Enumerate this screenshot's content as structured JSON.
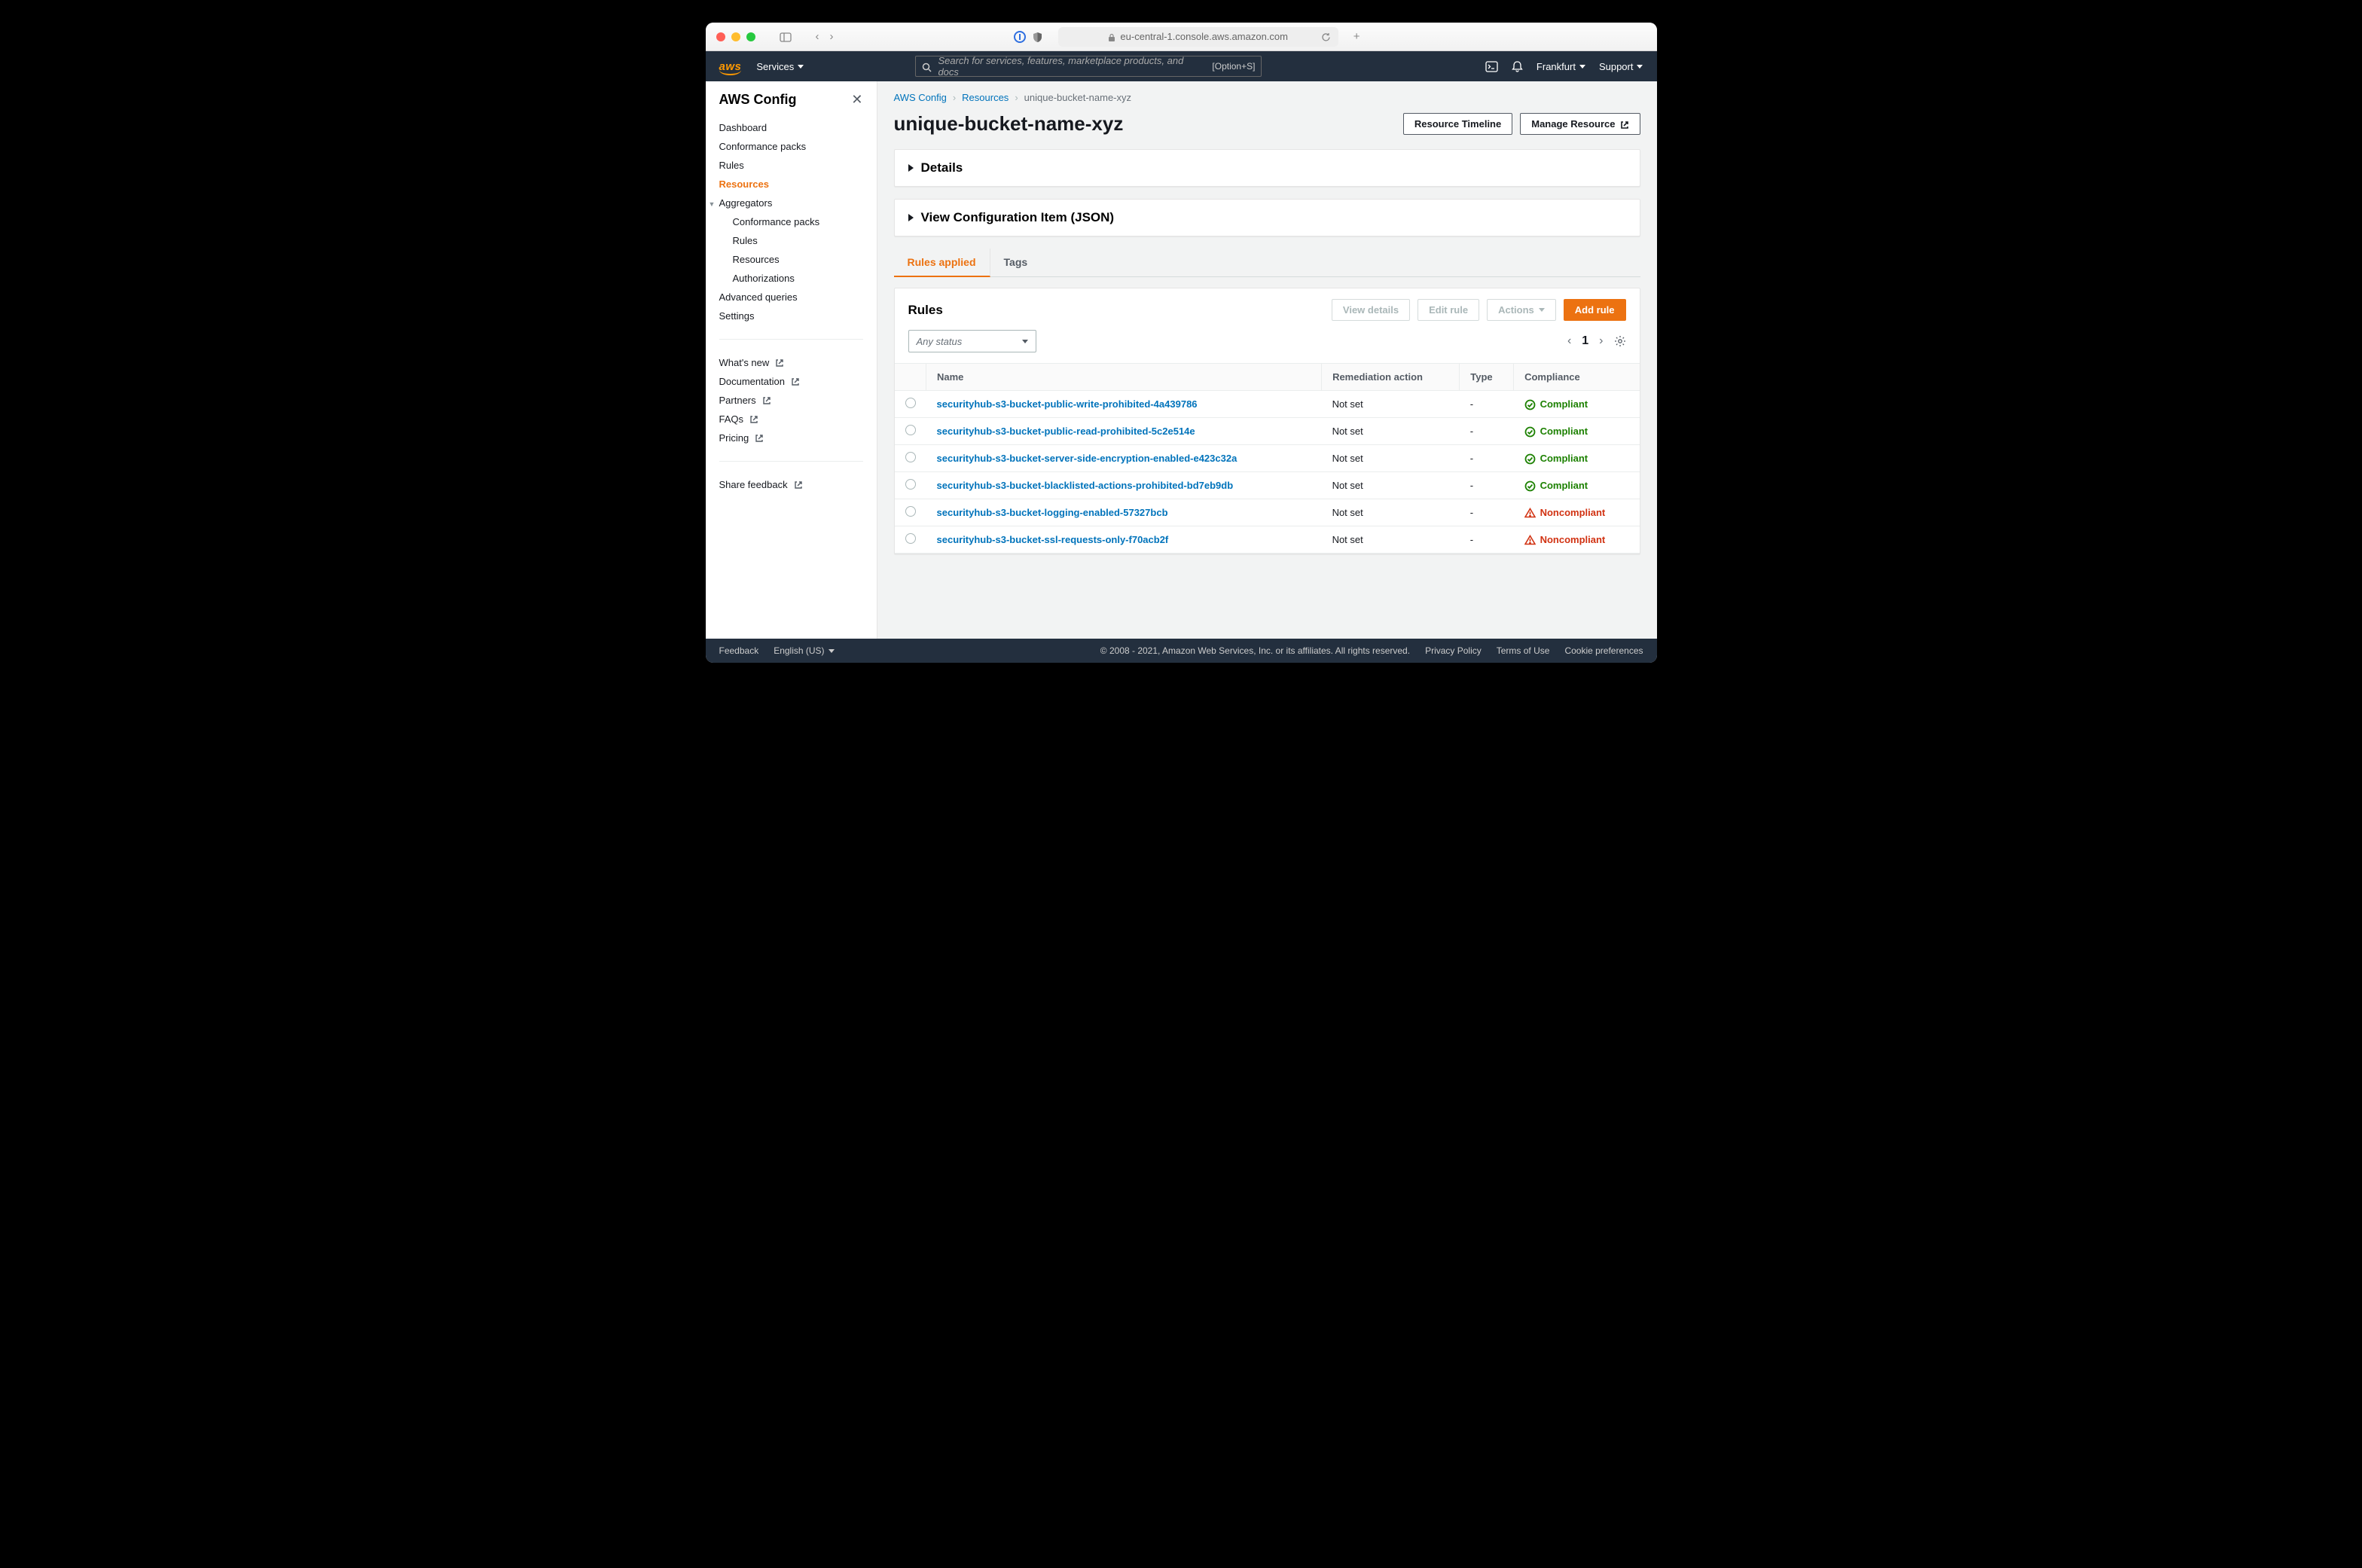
{
  "browser": {
    "url": "eu-central-1.console.aws.amazon.com"
  },
  "topnav": {
    "services": "Services",
    "search_placeholder": "Search for services, features, marketplace products, and docs",
    "search_hint": "[Option+S]",
    "region": "Frankfurt",
    "support": "Support"
  },
  "sidebar": {
    "title": "AWS Config",
    "items": [
      {
        "label": "Dashboard"
      },
      {
        "label": "Conformance packs"
      },
      {
        "label": "Rules"
      },
      {
        "label": "Resources",
        "active": true
      },
      {
        "label": "Aggregators",
        "expandable": true
      },
      {
        "label": "Conformance packs",
        "sub": true
      },
      {
        "label": "Rules",
        "sub": true
      },
      {
        "label": "Resources",
        "sub": true
      },
      {
        "label": "Authorizations",
        "sub": true
      },
      {
        "label": "Advanced queries"
      },
      {
        "label": "Settings"
      }
    ],
    "ext": [
      {
        "label": "What's new"
      },
      {
        "label": "Documentation"
      },
      {
        "label": "Partners"
      },
      {
        "label": "FAQs"
      },
      {
        "label": "Pricing"
      }
    ],
    "share": "Share feedback"
  },
  "breadcrumbs": [
    {
      "label": "AWS Config",
      "link": true
    },
    {
      "label": "Resources",
      "link": true
    },
    {
      "label": "unique-bucket-name-xyz"
    }
  ],
  "page": {
    "title": "unique-bucket-name-xyz",
    "timeline_btn": "Resource Timeline",
    "manage_btn": "Manage Resource"
  },
  "panels": {
    "details": "Details",
    "json": "View Configuration Item (JSON)"
  },
  "tabs": {
    "applied": "Rules applied",
    "tags": "Tags"
  },
  "rules": {
    "heading": "Rules",
    "view_btn": "View details",
    "edit_btn": "Edit rule",
    "actions_btn": "Actions",
    "add_btn": "Add rule",
    "filter_placeholder": "Any status",
    "page": "1",
    "cols": {
      "name": "Name",
      "remediation": "Remediation action",
      "type": "Type",
      "compliance": "Compliance"
    },
    "rows": [
      {
        "name": "securityhub-s3-bucket-public-write-prohibited-4a439786",
        "rem": "Not set",
        "type": "-",
        "comp": "Compliant"
      },
      {
        "name": "securityhub-s3-bucket-public-read-prohibited-5c2e514e",
        "rem": "Not set",
        "type": "-",
        "comp": "Compliant"
      },
      {
        "name": "securityhub-s3-bucket-server-side-encryption-enabled-e423c32a",
        "rem": "Not set",
        "type": "-",
        "comp": "Compliant"
      },
      {
        "name": "securityhub-s3-bucket-blacklisted-actions-prohibited-bd7eb9db",
        "rem": "Not set",
        "type": "-",
        "comp": "Compliant"
      },
      {
        "name": "securityhub-s3-bucket-logging-enabled-57327bcb",
        "rem": "Not set",
        "type": "-",
        "comp": "Noncompliant"
      },
      {
        "name": "securityhub-s3-bucket-ssl-requests-only-f70acb2f",
        "rem": "Not set",
        "type": "-",
        "comp": "Noncompliant"
      }
    ]
  },
  "footer": {
    "feedback": "Feedback",
    "lang": "English (US)",
    "copyright": "© 2008 - 2021, Amazon Web Services, Inc. or its affiliates. All rights reserved.",
    "privacy": "Privacy Policy",
    "terms": "Terms of Use",
    "cookies": "Cookie preferences"
  }
}
